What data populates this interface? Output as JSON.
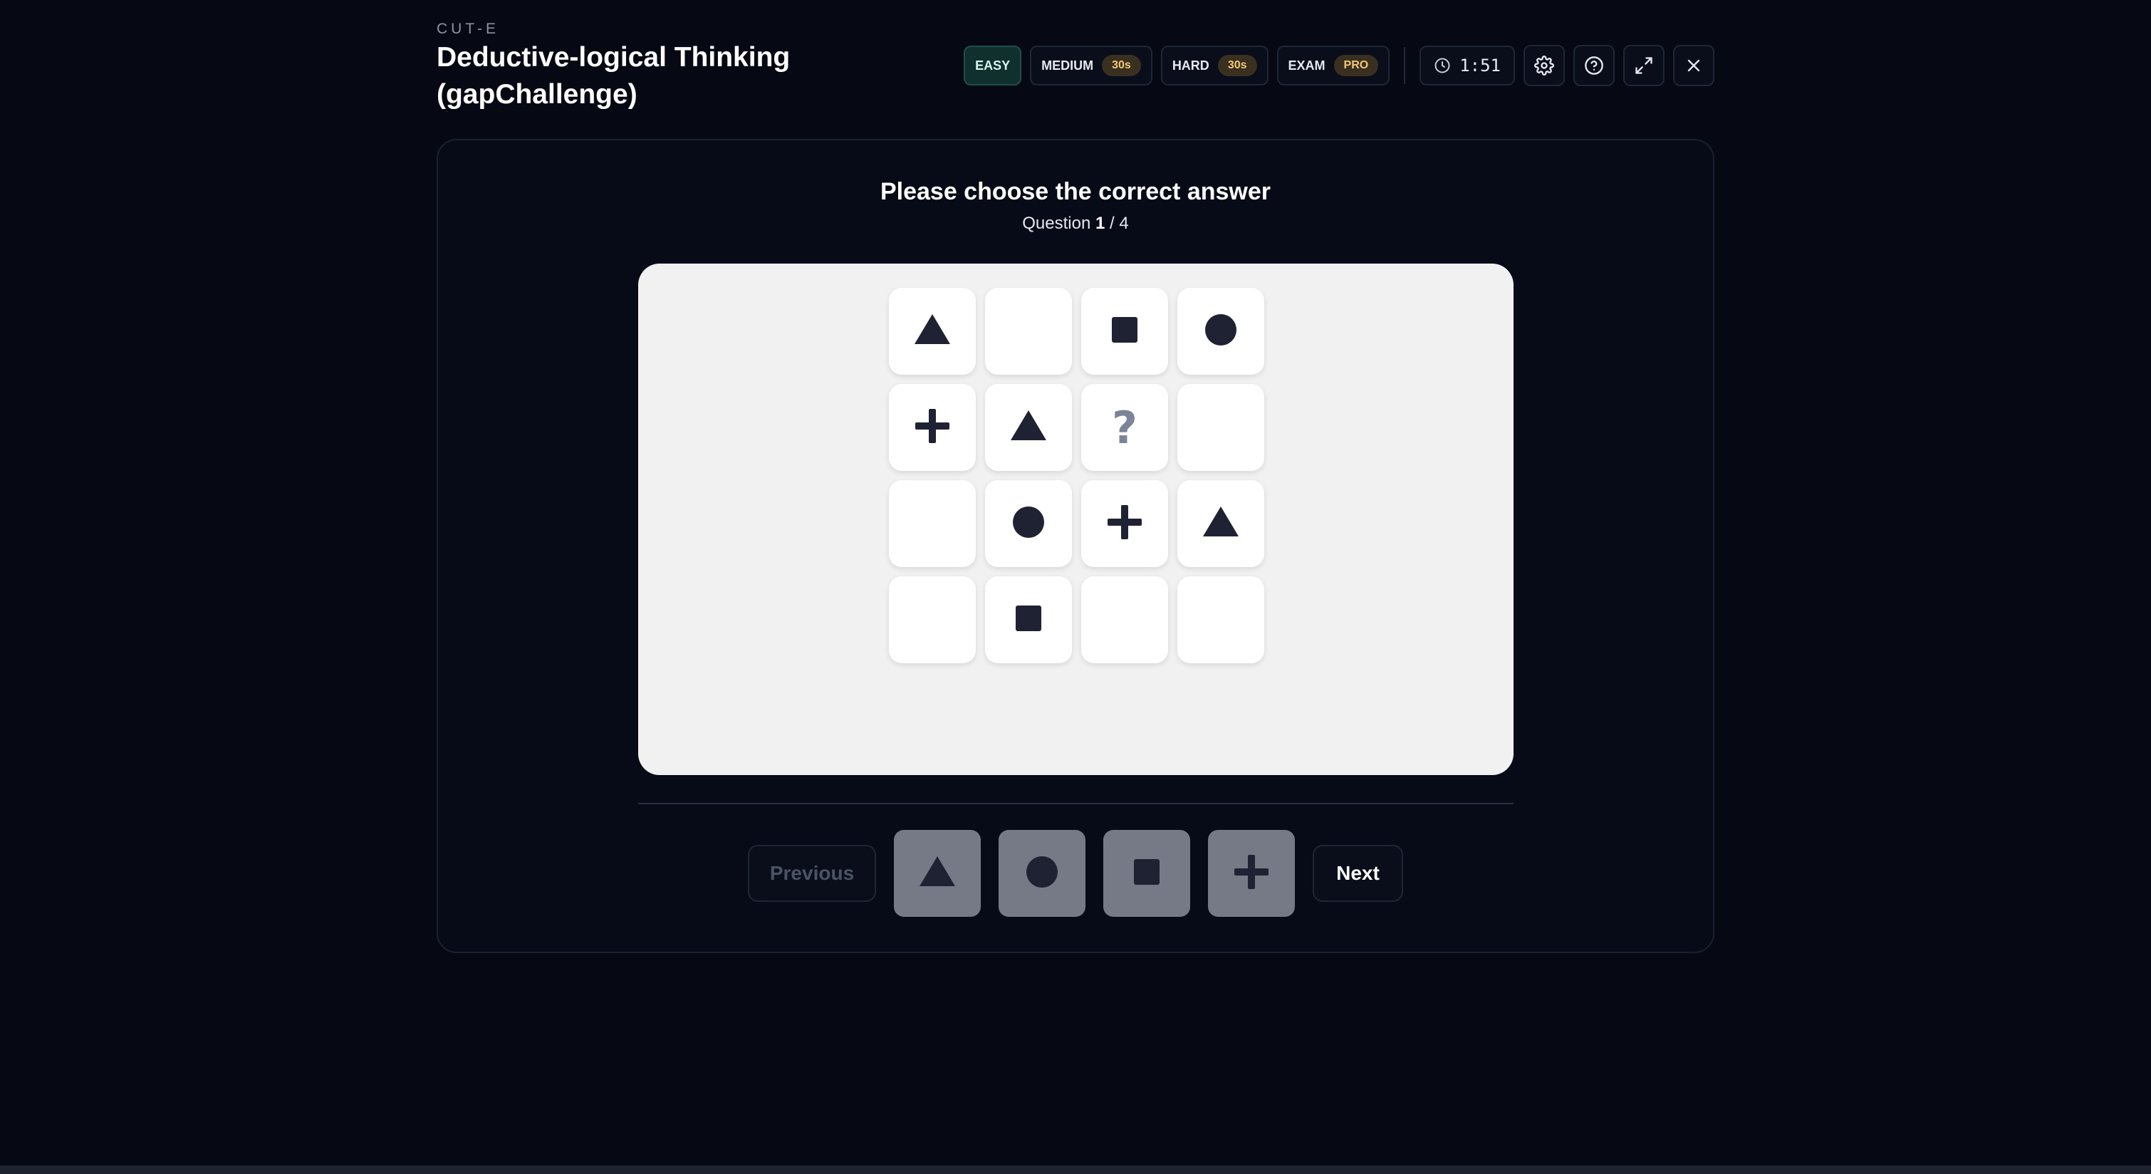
{
  "header": {
    "brand": "CUT-E",
    "title": "Deductive-logical Thinking (gapChallenge)"
  },
  "difficulty": [
    {
      "label": "EASY",
      "badge": null,
      "active": true
    },
    {
      "label": "MEDIUM",
      "badge": "30s",
      "active": false
    },
    {
      "label": "HARD",
      "badge": "30s",
      "active": false
    },
    {
      "label": "EXAM",
      "badge": "PRO",
      "active": false
    }
  ],
  "timer": {
    "value": "1:51",
    "icon": "clock-icon"
  },
  "toolbar_icons": [
    "gear-icon",
    "help-circle-icon",
    "expand-icon",
    "close-icon"
  ],
  "question": {
    "prompt": "Please choose the correct answer",
    "label": "Question",
    "current": "1",
    "separator": "/",
    "total": "4"
  },
  "grid": [
    [
      "triangle",
      "",
      "square",
      "circle"
    ],
    [
      "plus",
      "triangle",
      "?",
      ""
    ],
    [
      "",
      "circle",
      "plus",
      "triangle"
    ],
    [
      "",
      "square",
      "",
      ""
    ]
  ],
  "options": [
    "triangle",
    "circle",
    "square",
    "plus"
  ],
  "nav": {
    "previous": "Previous",
    "next": "Next"
  },
  "colors": {
    "background": "#060914",
    "board": "#f1f1f1",
    "shape": "#1e2233",
    "option_bg": "#757a86",
    "active_difficulty": "#10302e",
    "badge_text": "#f2c873"
  }
}
